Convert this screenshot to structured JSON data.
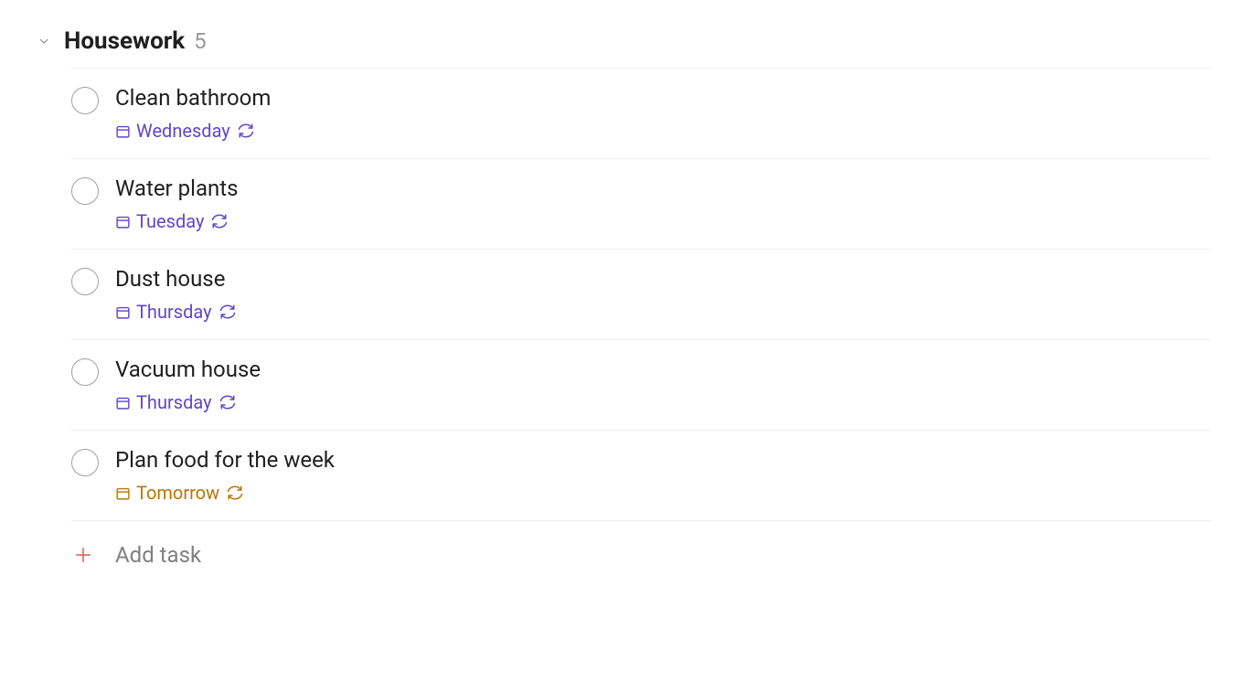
{
  "section": {
    "title": "Housework",
    "count": "5"
  },
  "tasks": [
    {
      "title": "Clean bathroom",
      "date": "Wednesday",
      "dateColor": "purple",
      "recurring": true
    },
    {
      "title": "Water plants",
      "date": "Tuesday",
      "dateColor": "purple",
      "recurring": true
    },
    {
      "title": "Dust house",
      "date": "Thursday",
      "dateColor": "purple",
      "recurring": true
    },
    {
      "title": "Vacuum house",
      "date": "Thursday",
      "dateColor": "purple",
      "recurring": true
    },
    {
      "title": "Plan food for the week",
      "date": "Tomorrow",
      "dateColor": "orange",
      "recurring": true
    }
  ],
  "addTaskLabel": "Add task"
}
